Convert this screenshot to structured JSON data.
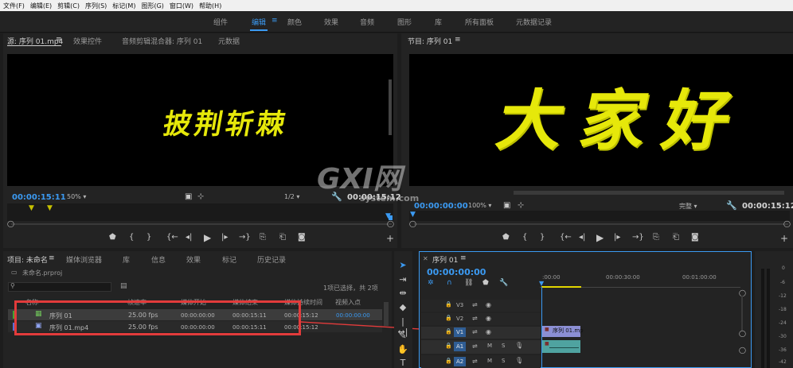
{
  "menu": [
    "文件(F)",
    "编辑(E)",
    "剪辑(C)",
    "序列(S)",
    "标记(M)",
    "图形(G)",
    "窗口(W)",
    "帮助(H)"
  ],
  "workspaces": [
    "组件",
    "编辑",
    "颜色",
    "效果",
    "音频",
    "图形",
    "库",
    "所有面板",
    "元数据记录"
  ],
  "source": {
    "tabs": [
      "源: 序列 01.mp4",
      "效果控件",
      "音频剪辑混合器: 序列 01",
      "元数据"
    ],
    "caption": "披荆斩棘",
    "timecode_in": "00:00:15:11",
    "zoom": "50%",
    "resolution": "1/2",
    "timecode_out": "00:00:15:12"
  },
  "program": {
    "tab": "节目: 序列 01",
    "caption": "大家好",
    "timecode_in": "00:00:00:00",
    "zoom": "100%",
    "quality": "完整",
    "timecode_out": "00:00:15:12"
  },
  "project": {
    "tabs": [
      "项目: 未命名",
      "媒体浏览器",
      "库",
      "信息",
      "效果",
      "标记",
      "历史记录"
    ],
    "file": "未命名.prproj",
    "status": "1项已选择，共 2项",
    "columns": [
      "名称",
      "帧速率",
      "媒体开始",
      "媒体结束",
      "媒体持续时间",
      "视频入点"
    ],
    "rows": [
      {
        "name": "序列 01",
        "fps": "25.00 fps",
        "start": "00:00:00:00",
        "end": "00:00:15:11",
        "duration": "00:00:15:12",
        "in": "00:00:00:00",
        "color": "#46a332"
      },
      {
        "name": "序列 01.mp4",
        "fps": "25.00 fps",
        "start": "00:00:00:00",
        "end": "00:00:15:11",
        "duration": "00:00:15:12",
        "in": "00:00:00:00",
        "color": "#5a6fd6"
      }
    ]
  },
  "timeline": {
    "tab": "序列 01",
    "timecode": "00:00:00:00",
    "ruler": [
      ":00:00",
      "00:00:30:00",
      "00:01:00:00"
    ],
    "tracks": [
      "V3",
      "V2",
      "V1",
      "A1",
      "A2"
    ],
    "clip_label": "序列 01.mp",
    "meter": [
      "0",
      "-6",
      "-12",
      "-18",
      "-24",
      "-30",
      "-36",
      "-42"
    ]
  },
  "watermark": {
    "logo": "GXI网",
    "domain": "system.com"
  },
  "colors": {
    "accent": "#3b9af2",
    "caption": "#e6e80a",
    "highlight": "#e23b3b"
  }
}
